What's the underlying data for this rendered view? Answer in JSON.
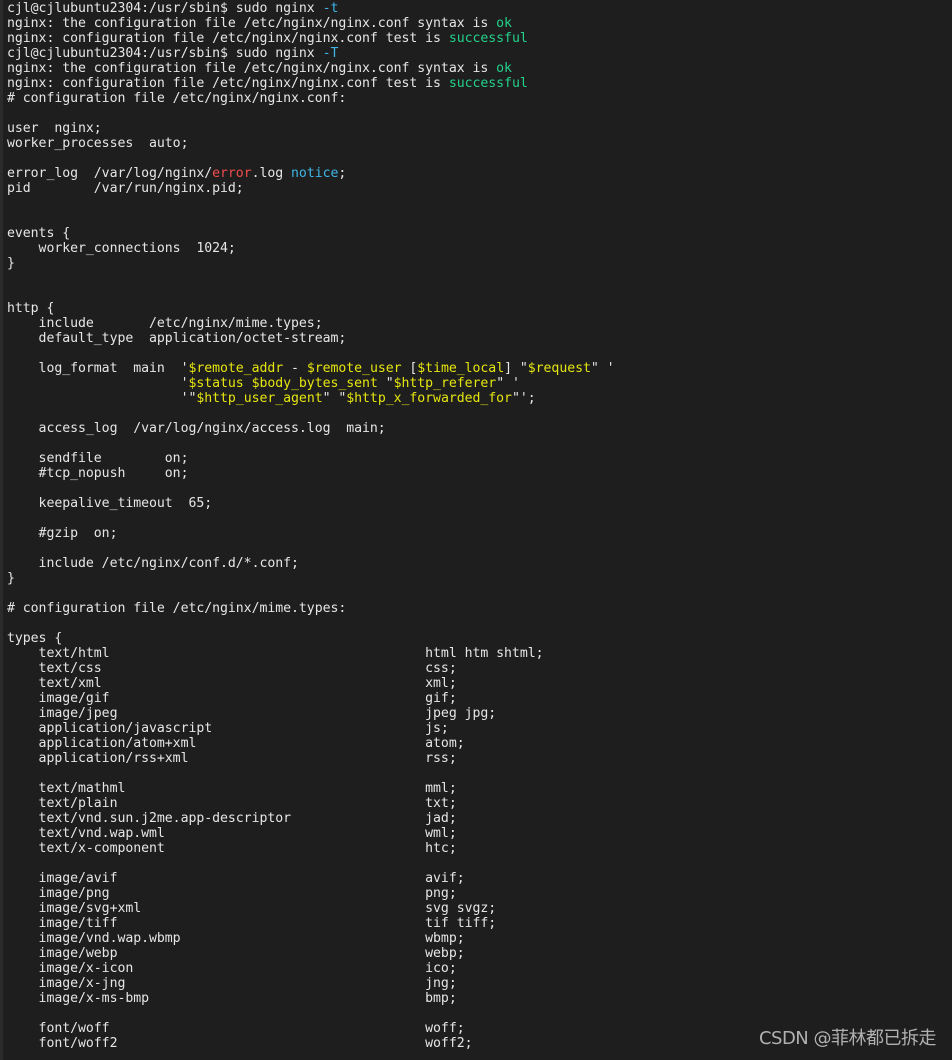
{
  "terminal": {
    "lines": [
      [
        {
          "t": "cjl@cjlubuntu2304:/usr/sbin$ sudo nginx "
        },
        {
          "t": "-t",
          "c": "cyan"
        }
      ],
      [
        {
          "t": "nginx: the configuration file /etc/nginx/nginx.conf syntax is "
        },
        {
          "t": "ok",
          "c": "green"
        }
      ],
      [
        {
          "t": "nginx: configuration file /etc/nginx/nginx.conf test is "
        },
        {
          "t": "successful",
          "c": "green"
        }
      ],
      [
        {
          "t": "cjl@cjlubuntu2304:/usr/sbin$ sudo nginx "
        },
        {
          "t": "-T",
          "c": "cyan"
        }
      ],
      [
        {
          "t": "nginx: the configuration file /etc/nginx/nginx.conf syntax is "
        },
        {
          "t": "ok",
          "c": "green"
        }
      ],
      [
        {
          "t": "nginx: configuration file /etc/nginx/nginx.conf test is "
        },
        {
          "t": "successful",
          "c": "green"
        }
      ],
      [
        {
          "t": "# configuration file /etc/nginx/nginx.conf:"
        }
      ],
      [
        {
          "t": ""
        }
      ],
      [
        {
          "t": "user  nginx;"
        }
      ],
      [
        {
          "t": "worker_processes  auto;"
        }
      ],
      [
        {
          "t": ""
        }
      ],
      [
        {
          "t": "error_log  /var/log/nginx/"
        },
        {
          "t": "error",
          "c": "red"
        },
        {
          "t": ".log "
        },
        {
          "t": "notice",
          "c": "cyan"
        },
        {
          "t": ";"
        }
      ],
      [
        {
          "t": "pid        /var/run/nginx.pid;"
        }
      ],
      [
        {
          "t": ""
        }
      ],
      [
        {
          "t": ""
        }
      ],
      [
        {
          "t": "events {"
        }
      ],
      [
        {
          "t": "    worker_connections  1024;"
        }
      ],
      [
        {
          "t": "}"
        }
      ],
      [
        {
          "t": ""
        }
      ],
      [
        {
          "t": ""
        }
      ],
      [
        {
          "t": "http {"
        }
      ],
      [
        {
          "t": "    include       /etc/nginx/mime.types;"
        }
      ],
      [
        {
          "t": "    default_type  application/octet-stream;"
        }
      ],
      [
        {
          "t": ""
        }
      ],
      [
        {
          "t": "    log_format  main  '"
        },
        {
          "t": "$remote_addr",
          "c": "yellow"
        },
        {
          "t": " - "
        },
        {
          "t": "$remote_user",
          "c": "yellow"
        },
        {
          "t": " ["
        },
        {
          "t": "$time_local",
          "c": "yellow"
        },
        {
          "t": "] \""
        },
        {
          "t": "$request",
          "c": "yellow"
        },
        {
          "t": "\" '"
        }
      ],
      [
        {
          "t": "                      '"
        },
        {
          "t": "$status $body_bytes_sent",
          "c": "yellow"
        },
        {
          "t": " \""
        },
        {
          "t": "$http_referer",
          "c": "yellow"
        },
        {
          "t": "\" '"
        }
      ],
      [
        {
          "t": "                      '\""
        },
        {
          "t": "$http_user_agent",
          "c": "yellow"
        },
        {
          "t": "\" \""
        },
        {
          "t": "$http_x_forwarded_for",
          "c": "yellow"
        },
        {
          "t": "\"';"
        }
      ],
      [
        {
          "t": ""
        }
      ],
      [
        {
          "t": "    access_log  /var/log/nginx/access.log  main;"
        }
      ],
      [
        {
          "t": ""
        }
      ],
      [
        {
          "t": "    sendfile        on;"
        }
      ],
      [
        {
          "t": "    #tcp_nopush     on;"
        }
      ],
      [
        {
          "t": ""
        }
      ],
      [
        {
          "t": "    keepalive_timeout  65;"
        }
      ],
      [
        {
          "t": ""
        }
      ],
      [
        {
          "t": "    #gzip  on;"
        }
      ],
      [
        {
          "t": ""
        }
      ],
      [
        {
          "t": "    include /etc/nginx/conf.d/*.conf;"
        }
      ],
      [
        {
          "t": "}"
        }
      ],
      [
        {
          "t": ""
        }
      ],
      [
        {
          "t": "# configuration file /etc/nginx/mime.types:"
        }
      ],
      [
        {
          "t": ""
        }
      ],
      [
        {
          "t": "types {"
        }
      ],
      [
        {
          "t": "    text/html                                        html htm shtml;"
        }
      ],
      [
        {
          "t": "    text/css                                         css;"
        }
      ],
      [
        {
          "t": "    text/xml                                         xml;"
        }
      ],
      [
        {
          "t": "    image/gif                                        gif;"
        }
      ],
      [
        {
          "t": "    image/jpeg                                       jpeg jpg;"
        }
      ],
      [
        {
          "t": "    application/javascript                           js;"
        }
      ],
      [
        {
          "t": "    application/atom+xml                             atom;"
        }
      ],
      [
        {
          "t": "    application/rss+xml                              rss;"
        }
      ],
      [
        {
          "t": ""
        }
      ],
      [
        {
          "t": "    text/mathml                                      mml;"
        }
      ],
      [
        {
          "t": "    text/plain                                       txt;"
        }
      ],
      [
        {
          "t": "    text/vnd.sun.j2me.app-descriptor                 jad;"
        }
      ],
      [
        {
          "t": "    text/vnd.wap.wml                                 wml;"
        }
      ],
      [
        {
          "t": "    text/x-component                                 htc;"
        }
      ],
      [
        {
          "t": ""
        }
      ],
      [
        {
          "t": "    image/avif                                       avif;"
        }
      ],
      [
        {
          "t": "    image/png                                        png;"
        }
      ],
      [
        {
          "t": "    image/svg+xml                                    svg svgz;"
        }
      ],
      [
        {
          "t": "    image/tiff                                       tif tiff;"
        }
      ],
      [
        {
          "t": "    image/vnd.wap.wbmp                               wbmp;"
        }
      ],
      [
        {
          "t": "    image/webp                                       webp;"
        }
      ],
      [
        {
          "t": "    image/x-icon                                     ico;"
        }
      ],
      [
        {
          "t": "    image/x-jng                                      jng;"
        }
      ],
      [
        {
          "t": "    image/x-ms-bmp                                   bmp;"
        }
      ],
      [
        {
          "t": ""
        }
      ],
      [
        {
          "t": "    font/woff                                        woff;"
        }
      ],
      [
        {
          "t": "    font/woff2                                       woff2;"
        }
      ]
    ]
  },
  "colors": {
    "background": "#1e1e1e",
    "foreground": "#e6e6e6",
    "cyan": "#3fb6e6",
    "green": "#23d18b",
    "red": "#f14c4c",
    "yellow": "#e5e510"
  },
  "watermark": {
    "text": "CSDN @菲林都已拆走"
  }
}
